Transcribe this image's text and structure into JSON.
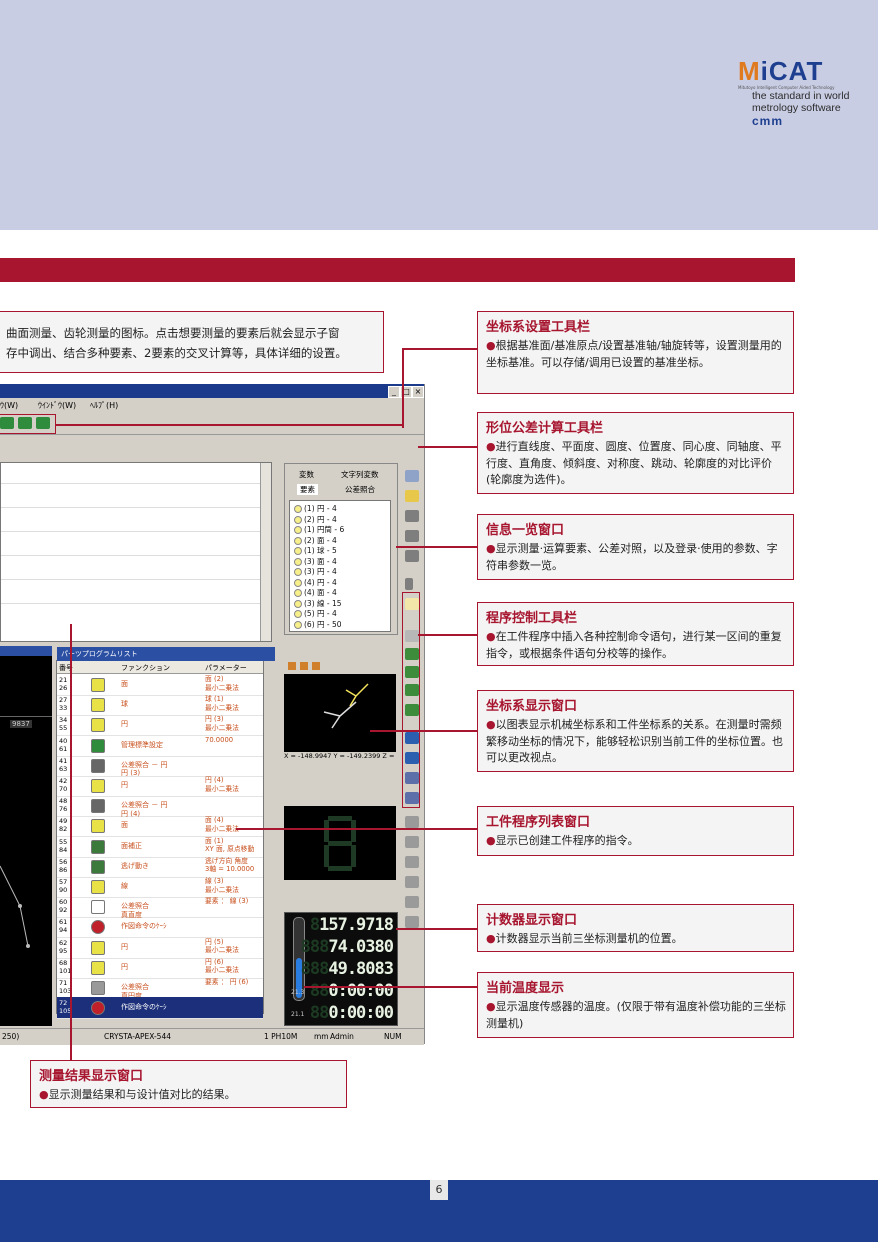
{
  "brand": {
    "logo_text": "MiCAT",
    "logo_sub": "Mitutoyo Intelligent Computer Aided Technology",
    "tagline_1": "the standard in world",
    "tagline_2": "metrology software",
    "product": "cmm"
  },
  "intro": {
    "line_1": "曲面测量、齿轮测量的图标。点击想要测量的要素后就会显示子窗",
    "line_2": "存中调出、结合多种要素、2要素的交叉计算等，具体详细的设置。"
  },
  "callouts": [
    {
      "title": "坐标系设置工具栏",
      "body": "根据基准面/基准原点/设置基准轴/轴旋转等，设置测量用的坐标基准。可以存储/调用已设置的基准坐标。"
    },
    {
      "title": "形位公差计算工具栏",
      "body": "进行直线度、平面度、圆度、位置度、同心度、同轴度、平行度、直角度、倾斜度、对称度、跳动、轮廓度的对比评价(轮廓度为选件)。"
    },
    {
      "title": "信息一览窗口",
      "body": "显示测量·运算要素、公差对照，以及登录·使用的参数、字符串参数一览。"
    },
    {
      "title": "程序控制工具栏",
      "body": "在工件程序中插入各种控制命令语句，进行某一区间的重复指令，或根据条件语句分校等的操作。"
    },
    {
      "title": "坐标系显示窗口",
      "body": "以图表显示机械坐标系和工件坐标系的关系。在测量时需频繁移动坐标的情况下，能够轻松识别当前工件的坐标位置。也可以更改视点。"
    },
    {
      "title": "工件程序列表窗口",
      "body": "显示已创建工件程序的指令。"
    },
    {
      "title": "计数器显示窗口",
      "body": "计数器显示当前三坐标测量机的位置。"
    },
    {
      "title": "当前温度显示",
      "body": "显示温度传感器的温度。(仅限于带有温度补偿功能的三坐标测量机)"
    }
  ],
  "bottom_callout": {
    "title": "测量结果显示窗口",
    "body": "显示测量结果和与设计值对比的结果。"
  },
  "page_number": "6",
  "screenshot": {
    "menu": [
      "ｳ(W)",
      "ｳｲﾝﾄﾞｳ(W)",
      "ﾍﾙﾌﾟ(H)"
    ],
    "tabs": [
      "変数",
      "文字列変数",
      "要素",
      "公差照合"
    ],
    "elements": [
      "(1) 円 - 4",
      "(2) 円 - 4",
      "(1) 円筒 - 6",
      "(2) 面 - 4",
      "(1) 球 - 5",
      "(3) 面 - 4",
      "(3) 円 - 4",
      "(4) 円 - 4",
      "(4) 面 - 4",
      "(3) 線 - 15",
      "(5) 円 - 4",
      "(6) 円 - 50"
    ],
    "prog_header": "パーツプログラムリスト",
    "prog_cols": [
      "番号",
      "ファンクション",
      "パラメーター"
    ],
    "prog_rows": [
      {
        "no": "21\n26",
        "fn": "面",
        "pa": "面 (2)\n最小二乗法"
      },
      {
        "no": "27\n33",
        "fn": "球",
        "pa": "球 (1)\n最小二乗法"
      },
      {
        "no": "34\n55",
        "fn": "円",
        "pa": "円 (3)\n最小二乗法"
      },
      {
        "no": "40\n61",
        "fn": "管理標準設定",
        "pa": "70.0000"
      },
      {
        "no": "41\n63",
        "fn": "公差照合 － 円\n円 (3)",
        "pa": ""
      },
      {
        "no": "42\n70",
        "fn": "円",
        "pa": "円 (4)\n最小二乗法"
      },
      {
        "no": "48\n76",
        "fn": "公差照合 － 円\n円 (4)",
        "pa": ""
      },
      {
        "no": "49\n82",
        "fn": "面",
        "pa": "面 (4)\n最小二乗法"
      },
      {
        "no": "55\n84",
        "fn": "面補正",
        "pa": "面 (1)\nXY 面, 原点移動"
      },
      {
        "no": "56\n86",
        "fn": "逃げ動き",
        "pa": "逃げ方向 角度\n3軸 = 10.0000"
      },
      {
        "no": "57\n90",
        "fn": "線",
        "pa": "線 (3)\n最小二乗法"
      },
      {
        "no": "60\n92",
        "fn": "公差照合\n真直度",
        "pa": "要素 ： 線 (3)"
      },
      {
        "no": "61\n94",
        "fn": "作図命令のｹｰｼ",
        "pa": ""
      },
      {
        "no": "62\n95",
        "fn": "円",
        "pa": "円 (5)\n最小二乗法"
      },
      {
        "no": "68\n101",
        "fn": "円",
        "pa": "円 (6)\n最小二乗法"
      },
      {
        "no": "71\n103",
        "fn": "公差照合\n真円度",
        "pa": "要素 ： 円 (6)"
      },
      {
        "no": "72\n105",
        "fn": "作図命令のｹｰｼ",
        "pa": ""
      }
    ],
    "coord_readout": "X = -148.9947  Y = -149.2399  Z =",
    "left_value": "9837",
    "counter": {
      "x": "157.9718",
      "y": "74.0380",
      "z": "49.8083",
      "t1": "0:00:00",
      "t2": "0:00:00",
      "label_1": "21.3",
      "label_2": "21.1"
    },
    "status": {
      "left": "250)",
      "machine": "CRYSTA-APEX-544",
      "probe": "1 PH10M",
      "unit": "mm",
      "user": "Admin",
      "num": "NUM"
    }
  }
}
